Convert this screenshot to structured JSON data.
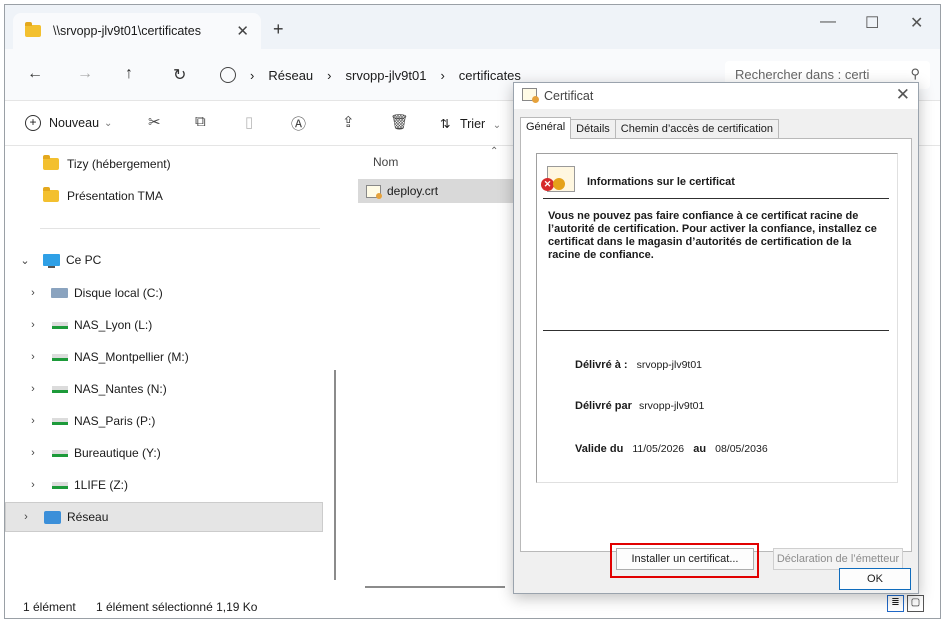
{
  "tab": {
    "title": "\\\\srvopp-jlv9t01\\certificates",
    "close": "✕",
    "new": "+"
  },
  "window_controls": {
    "minimize": "—",
    "maximize": "☐",
    "close": "✕"
  },
  "nav": {
    "back": "←",
    "forward": "→",
    "up": "↑",
    "refresh": "↻",
    "separator": "›"
  },
  "breadcrumb": [
    "Réseau",
    "srvopp-jlv9t01",
    "certificates"
  ],
  "search": {
    "placeholder": "Rechercher dans : certi",
    "icon": "⚲"
  },
  "toolbar": {
    "new_label": "Nouveau",
    "new_chevron": "⌄",
    "sort_label": "Trier",
    "sort_chevron": "⌄"
  },
  "sidebar": {
    "items": [
      {
        "label": "Tizy (hébergement)",
        "icon": "folder-icon"
      },
      {
        "label": "Présentation TMA",
        "icon": "folder-icon"
      },
      {
        "label": "Ce PC",
        "icon": "pc-icon"
      },
      {
        "label": "Disque local (C:)",
        "icon": "local-disk-icon"
      },
      {
        "label": "NAS_Lyon (L:)",
        "icon": "network-drive-icon"
      },
      {
        "label": "NAS_Montpellier (M:)",
        "icon": "network-drive-icon"
      },
      {
        "label": "NAS_Nantes (N:)",
        "icon": "network-drive-icon"
      },
      {
        "label": "NAS_Paris (P:)",
        "icon": "network-drive-icon"
      },
      {
        "label": "Bureautique (Y:)",
        "icon": "network-drive-icon"
      },
      {
        "label": "1LIFE (Z:)",
        "icon": "network-drive-icon"
      },
      {
        "label": "Réseau",
        "icon": "network-icon"
      }
    ],
    "chevron_right": "›",
    "chevron_down": "⌄"
  },
  "content": {
    "column_name": "Nom",
    "sort_arrow": "⌃",
    "file": "deploy.crt"
  },
  "status": {
    "count": "1 élément",
    "selected": "1 élément sélectionné  1,19 Ko"
  },
  "dialog": {
    "title": "Certificat",
    "close": "✕",
    "tabs": [
      "Général",
      "Détails",
      "Chemin d’accès de certification"
    ],
    "info_title": "Informations sur le certificat",
    "warning": "Vous ne pouvez pas faire confiance à ce certificat racine de l’autorité de certification. Pour activer la confiance, installez ce certificat dans le magasin d’autorités de certification de la racine de confiance.",
    "issued_to_label": "Délivré à :",
    "issued_to_value": "srvopp-jlv9t01",
    "issued_by_label": "Délivré par",
    "issued_by_value": "srvopp-jlv9t01",
    "valid_label": "Valide du",
    "valid_from": "11/05/2026",
    "valid_to_label": "au",
    "valid_to": "08/05/2036",
    "install_button": "Installer un certificat...",
    "issuer_statement_button": "Déclaration de l’émetteur",
    "ok_button": "OK"
  },
  "colors": {
    "highlight": "#e10000",
    "accent": "#0f6cbd",
    "folder": "#f3c02f",
    "drive_green": "#1d9a3a"
  }
}
